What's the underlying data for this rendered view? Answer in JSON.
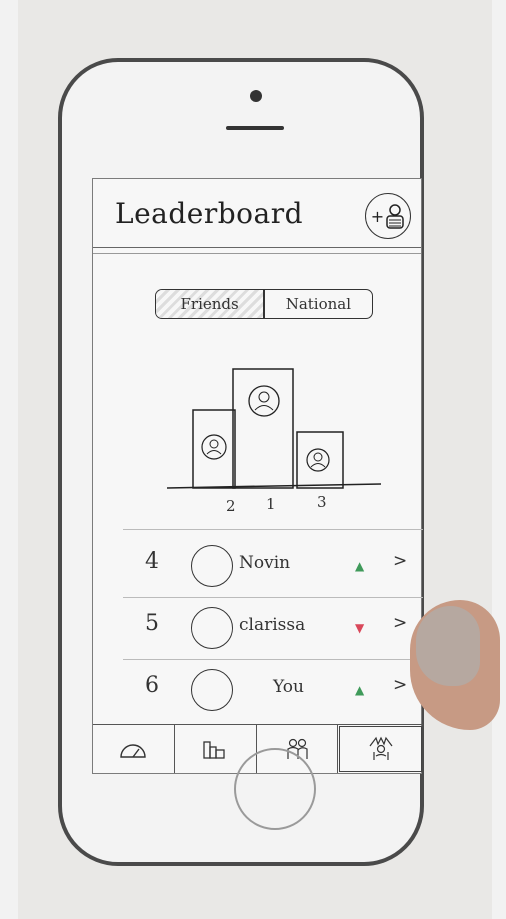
{
  "header": {
    "title": "Leaderboard",
    "add_icon": "add-user-icon"
  },
  "toggle": {
    "options": [
      "Friends",
      "National"
    ],
    "selected": "Friends"
  },
  "podium": {
    "places": [
      {
        "rank": "2",
        "icon": "avatar-icon"
      },
      {
        "rank": "1",
        "icon": "avatar-icon"
      },
      {
        "rank": "3",
        "icon": "avatar-icon"
      }
    ]
  },
  "list": [
    {
      "rank": "4",
      "name": "Novin",
      "trend": "up",
      "trend_color": "#3f9a5a",
      "chevron": ">"
    },
    {
      "rank": "5",
      "name": "clarissa",
      "trend": "down",
      "trend_color": "#d9485a",
      "chevron": ">"
    },
    {
      "rank": "6",
      "name": "You",
      "trend": "up",
      "trend_color": "#3f9a5a",
      "chevron": ">"
    }
  ],
  "tabbar": {
    "tabs": [
      {
        "icon": "gauge-icon"
      },
      {
        "icon": "bar-chart-icon"
      },
      {
        "icon": "friends-icon"
      },
      {
        "icon": "leaderboard-icon",
        "active": true
      }
    ]
  }
}
